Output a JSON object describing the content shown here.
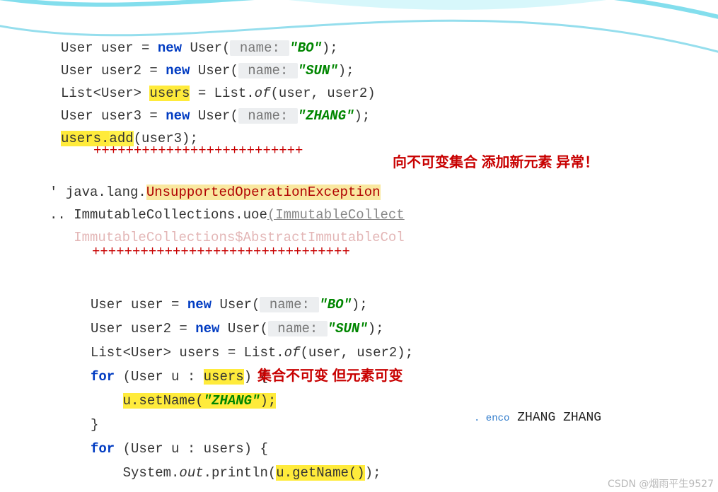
{
  "code_top": {
    "l1_a": "User user = ",
    "l1_new": "new",
    "l1_b": " User(",
    "l1_hint": " name: ",
    "l1_str": "\"BO\"",
    "l1_c": ");",
    "l2_a": "User user2 = ",
    "l2_new": "new",
    "l2_b": " User(",
    "l2_hint": " name: ",
    "l2_str": "\"SUN\"",
    "l2_c": ");",
    "l3_a": "List<User> ",
    "l3_users": "users",
    "l3_b": " = List.",
    "l3_of": "of",
    "l3_c": "(user, user2)",
    "l4_a": "User user3 = ",
    "l4_new": "new",
    "l4_b": " User(",
    "l4_hint": " name: ",
    "l4_str": "\"ZHANG\"",
    "l4_c": ");",
    "l5_users": "users.",
    "l5_add": "add",
    "l5_b": "(user3);"
  },
  "plus1": "++++++++++++++++++++++++++",
  "stack": {
    "dot1": "' ",
    "line1a": "java.lang.",
    "line1b": "UnsupportedOperationException",
    "dot2": ".. ",
    "line2a": "ImmutableCollections.uoe",
    "line2b": "(ImmutableCollect",
    "line3": "ImmutableCollections$AbstractImmutableCol"
  },
  "plus2": "++++++++++++++++++++++++++++++++",
  "note1": {
    "l1": "向不可变集合",
    "l2": "添加新元素",
    "l3": "异常！"
  },
  "code_bot": {
    "l1_a": "User user = ",
    "l1_new": "new",
    "l1_b": " User(",
    "l1_hint": " name: ",
    "l1_str": "\"BO\"",
    "l1_c": ");",
    "l2_a": "User user2 = ",
    "l2_new": "new",
    "l2_b": " User(",
    "l2_hint": " name: ",
    "l2_str": "\"SUN\"",
    "l2_c": ");",
    "l3_a": "List<User> users = List.",
    "l3_of": "of",
    "l3_b": "(user, user2);",
    "l4_for": "for",
    "l4_a": " (User u : ",
    "l4_users": "users",
    "l4_b": ") {",
    "l5_a": "    ",
    "l5_set": "u.setName(",
    "l5_str": "\"ZHANG\"",
    "l5_b": ");",
    "l6": "}",
    "l7_for": "for",
    "l7_a": " (User u : users) {",
    "l8_a": "    System.",
    "l8_out": "out",
    "l8_b": ".println(",
    "l8_get": "u.getName()",
    "l8_c": ");"
  },
  "note2": {
    "l1": "集合不可变",
    "l2": "但元素可变"
  },
  "output": {
    "hint": ". enco",
    "l1": "ZHANG",
    "l2": "ZHANG"
  },
  "watermark": "CSDN @烟雨平生9527"
}
